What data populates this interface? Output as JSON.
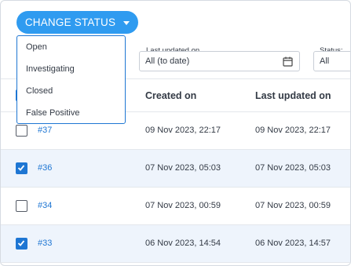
{
  "toolbar": {
    "change_status_label": "CHANGE STATUS"
  },
  "status_menu": {
    "items": [
      "Open",
      "Investigating",
      "Closed",
      "False Positive"
    ]
  },
  "filters": {
    "last_updated": {
      "label": "Last updated on",
      "value": "All (to date)"
    },
    "status": {
      "label": "Status:",
      "value": "All"
    }
  },
  "table": {
    "columns": {
      "created": "Created on",
      "updated": "Last updated on"
    },
    "rows": [
      {
        "id": "#37",
        "created": "09 Nov 2023, 22:17",
        "updated": "09 Nov 2023, 22:17",
        "checked": false
      },
      {
        "id": "#36",
        "created": "07 Nov 2023, 05:03",
        "updated": "07 Nov 2023, 05:03",
        "checked": true
      },
      {
        "id": "#34",
        "created": "07 Nov 2023, 00:59",
        "updated": "07 Nov 2023, 00:59",
        "checked": false
      },
      {
        "id": "#33",
        "created": "06 Nov 2023, 14:54",
        "updated": "06 Nov 2023, 14:57",
        "checked": true
      }
    ]
  },
  "colors": {
    "accent": "#2f9bf0",
    "link": "#1e76d3",
    "selected_row": "#eef4fc"
  }
}
